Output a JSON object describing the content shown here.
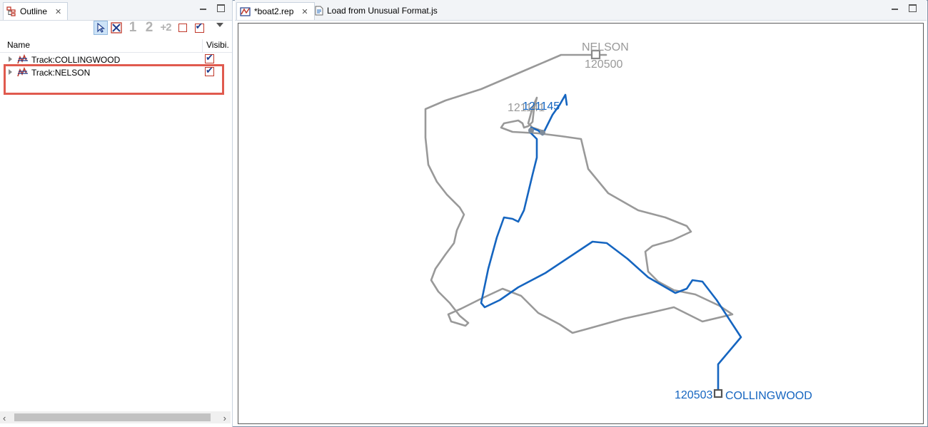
{
  "outline": {
    "tab_title": "Outline",
    "toolbar": {
      "num1": "1",
      "num2": "2",
      "num_plus2": "+2"
    },
    "columns": {
      "name": "Name",
      "visibility": "Visibi."
    },
    "tracks": [
      {
        "label": "Track:COLLINGWOOD",
        "visible": true
      },
      {
        "label": "Track:NELSON",
        "visible": true
      }
    ]
  },
  "editor": {
    "tabs": [
      {
        "label": "*boat2.rep",
        "active": true
      },
      {
        "label": "Load from Unusual Format.js",
        "active": false
      }
    ],
    "plot": {
      "nelson_name": "NELSON",
      "nelson_start_time": "120500",
      "nelson_end_time": "121141",
      "collingwood_name": "COLLINGWOOD",
      "collingwood_start_time": "120503",
      "collingwood_end_time": "121145",
      "colors": {
        "nelson": "#999999",
        "collingwood": "#1565c0"
      }
    }
  }
}
